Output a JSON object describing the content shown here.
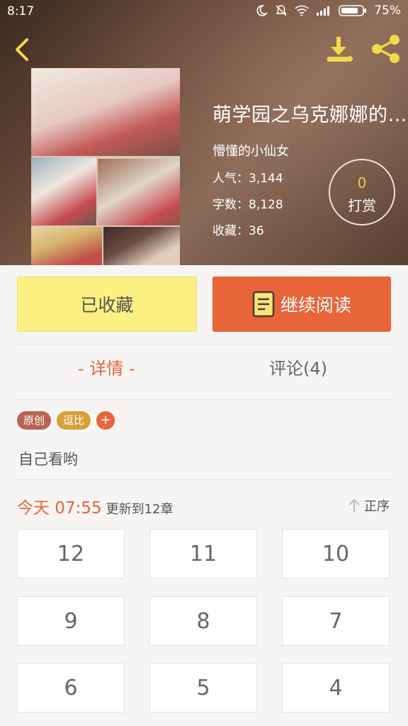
{
  "status_bar": {
    "time": "8:17",
    "battery": "75%"
  },
  "header": {
    "back_icon": "chevron-left-icon",
    "download_icon": "download-icon",
    "share_icon": "share-icon"
  },
  "book": {
    "title": "萌学园之乌克娜娜的…",
    "author": "懵懂的小仙女",
    "popularity_label": "人气：",
    "popularity": "3,144",
    "words_label": "字数：",
    "words": "8,128",
    "favorites_label": "收藏：",
    "favorites": "36"
  },
  "tip": {
    "count": "0",
    "label": "打赏"
  },
  "actions": {
    "favorited_label": "已收藏",
    "continue_label": "继续阅读"
  },
  "tabs": {
    "detail": "- 详情 -",
    "comments": "评论(4)"
  },
  "tags": [
    "原创",
    "逗比"
  ],
  "tag_add": "+",
  "description": "自己看哟",
  "update": {
    "when": "今天 07:55",
    "text": "更新到12章"
  },
  "sort_label": "正序",
  "chapters": [
    "12",
    "11",
    "10",
    "9",
    "8",
    "7",
    "6",
    "5",
    "4"
  ],
  "colors": {
    "accent": "#e8653a",
    "favorite_bg": "#fbf081",
    "tip_number": "#f3c64a"
  }
}
